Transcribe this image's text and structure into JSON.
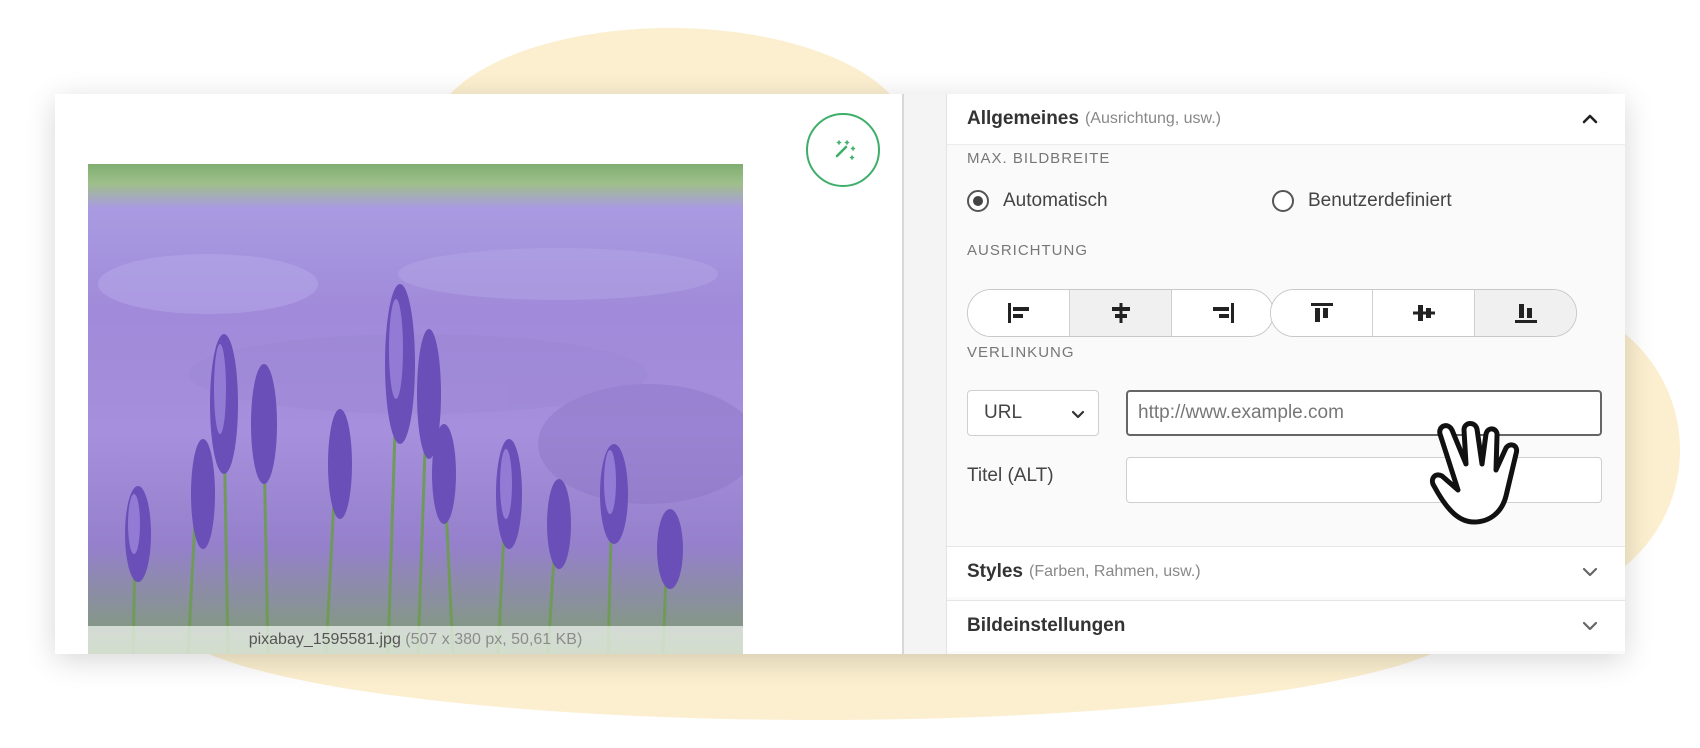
{
  "image": {
    "filename": "pixabay_1595581.jpg",
    "meta": "(507 x 380 px, 50,61 KB)"
  },
  "sections": {
    "general": {
      "title": "Allgemeines",
      "hint": "(Ausrichtung, usw.)",
      "expanded": true
    },
    "styles": {
      "title": "Styles",
      "hint": "(Farben, Rahmen, usw.)",
      "expanded": false
    },
    "image_settings": {
      "title": "Bildeinstellungen",
      "expanded": false
    }
  },
  "max_width": {
    "label": "MAX. BILDBREITE",
    "options": [
      {
        "label": "Automatisch",
        "selected": true
      },
      {
        "label": "Benutzerdefiniert",
        "selected": false
      }
    ]
  },
  "alignment": {
    "label": "AUSRICHTUNG",
    "horizontal": [
      {
        "icon": "align-left-icon",
        "active": false
      },
      {
        "icon": "align-center-icon",
        "active": true
      },
      {
        "icon": "align-right-icon",
        "active": false
      }
    ],
    "vertical": [
      {
        "icon": "align-top-icon",
        "active": false
      },
      {
        "icon": "align-middle-icon",
        "active": false
      },
      {
        "icon": "align-bottom-icon",
        "active": true
      }
    ]
  },
  "linking": {
    "label": "VERLINKUNG",
    "type_selected": "URL",
    "url_placeholder": "http://www.example.com",
    "alt_label": "Titel (ALT)",
    "alt_value": ""
  },
  "colors": {
    "accent_green": "#3fae6b",
    "lavender": "#a08ad9",
    "blob": "#fbefcf"
  }
}
